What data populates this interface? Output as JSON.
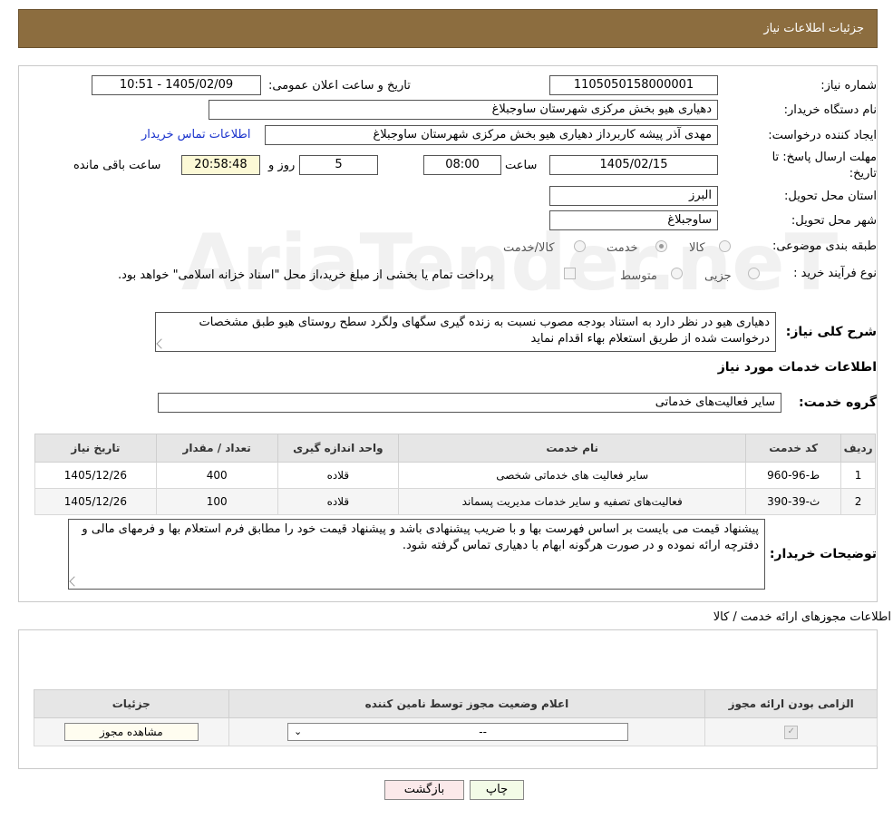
{
  "header": {
    "title": "جزئیات اطلاعات نیاز"
  },
  "fields": {
    "need_number_label": "شماره نیاز:",
    "need_number": "1105050158000001",
    "announce_label": "تاریخ و ساعت اعلان عمومی:",
    "announce_value": "1405/02/09 - 10:51",
    "buyer_org_label": "نام دستگاه خریدار:",
    "buyer_org": "دهیاری هیو بخش مرکزی شهرستان ساوجبلاغ",
    "creator_label": "ایجاد کننده درخواست:",
    "creator": "مهدی آذر پیشه کاربرداز دهیاری هیو بخش مرکزی شهرستان ساوجبلاغ",
    "contact_link": "اطلاعات تماس خریدار",
    "deadline_label_1": "مهلت ارسال پاسخ: تا",
    "deadline_label_2": "تاریخ:",
    "deadline_date": "1405/02/15",
    "time_label": "ساعت",
    "deadline_time": "08:00",
    "days_value": "5",
    "days_label": "روز و",
    "remaining_time": "20:58:48",
    "remaining_label": "ساعت باقی مانده",
    "province_label": "استان محل تحویل:",
    "province": "البرز",
    "city_label": "شهر محل تحویل:",
    "city": "ساوجبلاغ",
    "category_label": "طبقه بندی موضوعی:",
    "category_options": [
      "کالا",
      "خدمت",
      "کالا/خدمت"
    ],
    "category_selected": "خدمت",
    "process_label": "نوع فرآیند خرید :",
    "process_options": [
      "جزیی",
      "متوسط"
    ],
    "process_note": "پرداخت تمام یا بخشی از مبلغ خرید،از محل \"اسناد خزانه اسلامی\" خواهد بود."
  },
  "description": {
    "label": "شرح کلی نیاز:",
    "text": "دهیاری هیو در نظر دارد  به استناد بودجه مصوب نسبت به زنده گیری سگهای ولگرد سطح روستای هیو  طبق مشخصات درخواست شده از طریق استعلام بهاء اقدام نماید"
  },
  "services": {
    "section_title": "اطلاعات خدمات مورد نیاز",
    "group_label": "گروه خدمت:",
    "group_value": "سایر فعالیت‌های خدماتی",
    "columns": [
      "ردیف",
      "کد خدمت",
      "نام خدمت",
      "واحد اندازه گیری",
      "تعداد / مقدار",
      "تاریخ نیاز"
    ],
    "rows": [
      {
        "idx": "1",
        "code": "ط-96-960",
        "name": "سایر فعالیت های خدماتی شخصی",
        "unit": "قلاده",
        "qty": "400",
        "date": "1405/12/26"
      },
      {
        "idx": "2",
        "code": "ث-39-390",
        "name": "فعالیت‌های تصفیه و سایر خدمات مدیریت پسماند",
        "unit": "قلاده",
        "qty": "100",
        "date": "1405/12/26"
      }
    ]
  },
  "buyer_notes": {
    "label": "توضیحات خریدار:",
    "text": "پیشنهاد قیمت می بایست بر اساس فهرست بها و با ضریب پیشنهادی باشد و پیشنهاد قیمت خود را مطابق فرم استعلام بها  و فرمهای مالی و دفترچه ارائه نموده و در صورت هرگونه ابهام با دهیاری تماس گرفته شود."
  },
  "permits": {
    "section_title": "اطلاعات مجوزهای ارائه خدمت / کالا",
    "columns": [
      "الزامی بودن ارائه مجوز",
      "اعلام وضعیت مجوز توسط نامین کننده",
      "جزئیات"
    ],
    "select_value": "--",
    "view_button": "مشاهده مجوز"
  },
  "buttons": {
    "print": "چاپ",
    "back": "بازگشت"
  },
  "watermark": "AriaTender.neT"
}
